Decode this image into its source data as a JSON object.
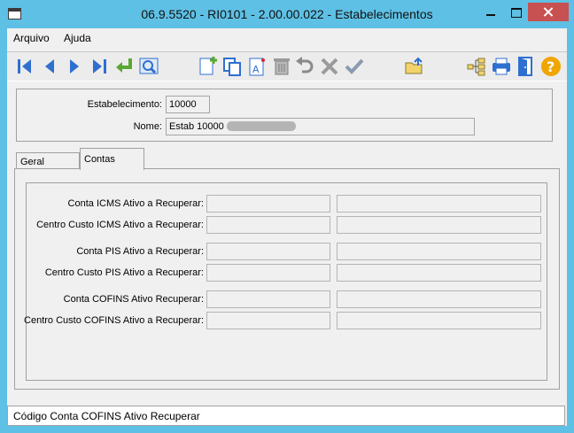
{
  "window": {
    "title": "06.9.5520 - RI0101 - 2.00.00.022 - Estabelecimentos"
  },
  "menu": {
    "items": [
      "Arquivo",
      "Ajuda"
    ]
  },
  "header": {
    "estabelecimento_label": "Estabelecimento:",
    "estabelecimento_value": "10000",
    "nome_label": "Nome:",
    "nome_value": "Estab 10000"
  },
  "tabs": [
    {
      "label": "Geral",
      "active": false
    },
    {
      "label": "Contas",
      "active": true
    }
  ],
  "contas": {
    "fields": [
      {
        "label": "Conta ICMS Ativo a Recuperar:",
        "code": "",
        "description": ""
      },
      {
        "label": "Centro Custo ICMS Ativo a Recuperar:",
        "code": "",
        "description": ""
      },
      {
        "label": "Conta PIS Ativo a Recuperar:",
        "code": "",
        "description": ""
      },
      {
        "label": "Centro Custo PIS Ativo a Recuperar:",
        "code": "",
        "description": ""
      },
      {
        "label": "Conta COFINS Ativo Recuperar:",
        "code": "",
        "description": ""
      },
      {
        "label": "Centro Custo COFINS Ativo a Recuperar:",
        "code": "",
        "description": ""
      }
    ]
  },
  "status": {
    "text": "Código Conta COFINS Ativo Recuperar"
  },
  "colors": {
    "titlebar": "#5ec0e4",
    "close_button": "#c75050",
    "icon_blue": "#2f6fd0",
    "help_icon": "#f0a500"
  },
  "toolbar_icons": [
    "first-record-icon",
    "previous-record-icon",
    "next-record-icon",
    "last-record-icon",
    "return-arrow-icon",
    "zoom-search-icon",
    "add-record-icon",
    "copy-record-icon",
    "edit-record-icon",
    "delete-record-icon",
    "undo-icon",
    "cancel-icon",
    "confirm-icon",
    "open-folder-icon",
    "tree-structure-icon",
    "printer-icon",
    "exit-door-icon",
    "help-icon"
  ]
}
